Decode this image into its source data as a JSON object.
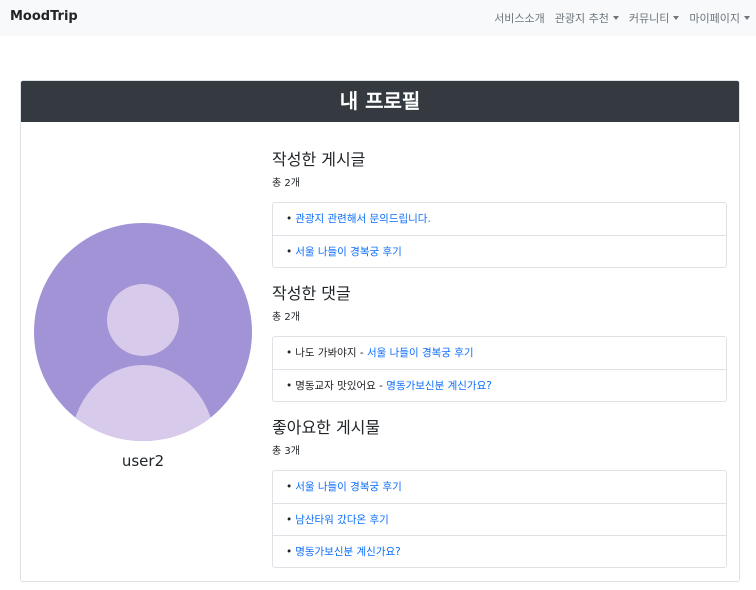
{
  "navbar": {
    "brand": "MoodTrip",
    "items": [
      {
        "label": "서비스소개",
        "dropdown": false
      },
      {
        "label": "관광지 추천",
        "dropdown": true
      },
      {
        "label": "커뮤니티",
        "dropdown": true
      },
      {
        "label": "마이페이지",
        "dropdown": true
      }
    ]
  },
  "profile": {
    "title": "내 프로필",
    "username": "user2",
    "avatar_colors": {
      "background": "#a293d7",
      "figure": "#d8caeb"
    }
  },
  "posts": {
    "title": "작성한 게시글",
    "count": "총 2개",
    "items": [
      "관광지 관련해서 문의드립니다.",
      "서울 나들이 경복궁 후기"
    ]
  },
  "comments": {
    "title": "작성한 댓글",
    "count": "총 2개",
    "items": [
      {
        "text": "나도 가봐야지",
        "sep": " - ",
        "post": "서울 나들이 경복궁 후기"
      },
      {
        "text": "명동교자 맛있어요",
        "sep": " - ",
        "post": "명동가보신분 계신가요?"
      }
    ]
  },
  "likes": {
    "title": "좋아요한 게시물",
    "count": "총 3개",
    "items": [
      "서울 나들이 경복궁 후기",
      "남산타워 갔다온 후기",
      "명동가보신분 계신가요?"
    ]
  },
  "colors": {
    "link": "#0d6efd",
    "header": "#343a40",
    "navbar": "#f8f9fa"
  }
}
